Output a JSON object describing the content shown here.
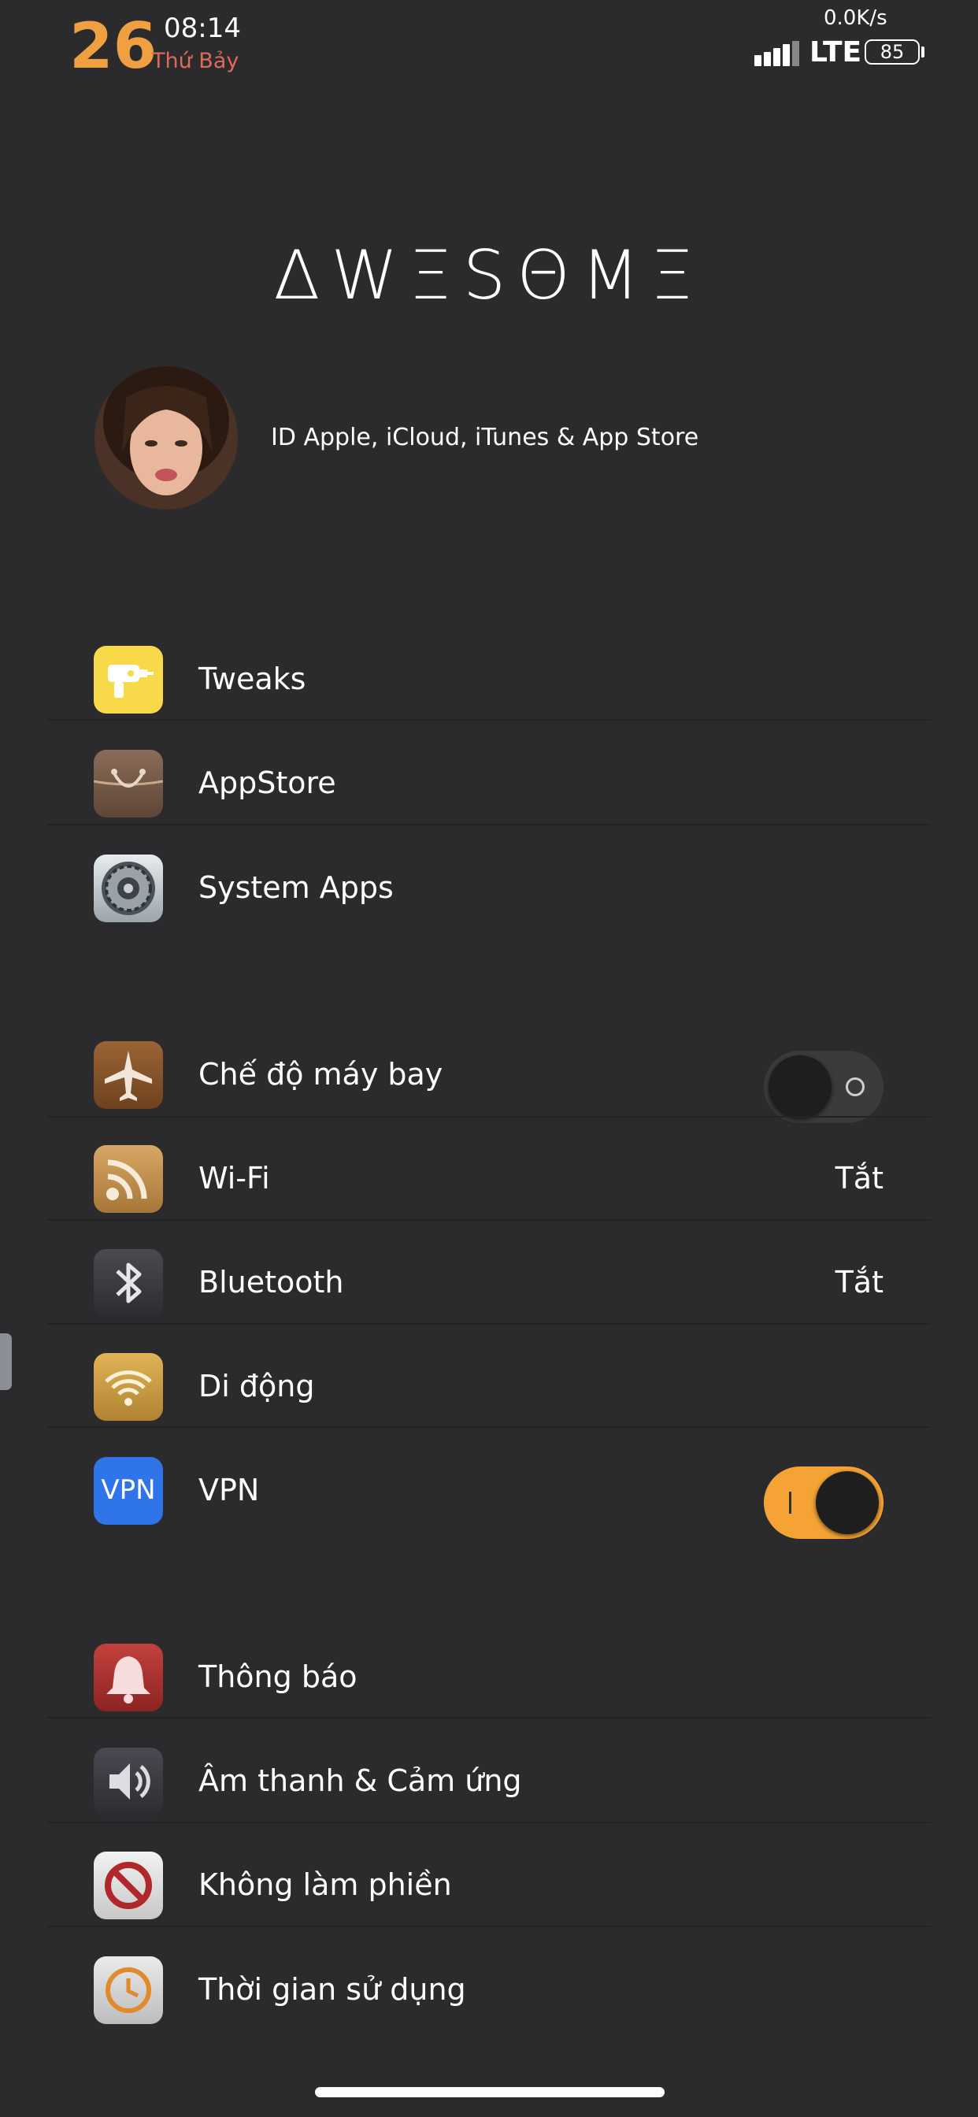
{
  "status_bar": {
    "day": "26",
    "time": "08:14",
    "weekday": "Thứ Bảy",
    "net_speed": "0.0K/s",
    "network": "LTE",
    "battery": "85"
  },
  "logo": "ΔWΞSΘMΞ",
  "profile": {
    "label": "ID Apple, iCloud, iTunes & App Store"
  },
  "group1": [
    {
      "label": "Tweaks",
      "icon": "drill-icon"
    },
    {
      "label": "AppStore",
      "icon": "shopping-bag-icon"
    },
    {
      "label": "System Apps",
      "icon": "gear-icon"
    }
  ],
  "group2": [
    {
      "label": "Chế độ máy bay",
      "icon": "airplane-icon",
      "toggle": false
    },
    {
      "label": "Wi-Fi",
      "icon": "wifi-icon",
      "value": "Tắt"
    },
    {
      "label": "Bluetooth",
      "icon": "bluetooth-icon",
      "value": "Tắt"
    },
    {
      "label": "Di động",
      "icon": "cellular-icon"
    },
    {
      "label": "VPN",
      "icon": "vpn-icon",
      "icon_text": "VPN",
      "toggle": true
    }
  ],
  "group3": [
    {
      "label": "Thông báo",
      "icon": "bell-icon"
    },
    {
      "label": "Âm thanh & Cảm ứng",
      "icon": "speaker-icon"
    },
    {
      "label": "Không làm phiền",
      "icon": "do-not-disturb-icon"
    },
    {
      "label": "Thời gian sử dụng",
      "icon": "screen-time-icon"
    }
  ],
  "colors": {
    "background": "#2b2b2d",
    "accent_orange": "#f5a335",
    "weekday_red": "#e06a5a"
  }
}
